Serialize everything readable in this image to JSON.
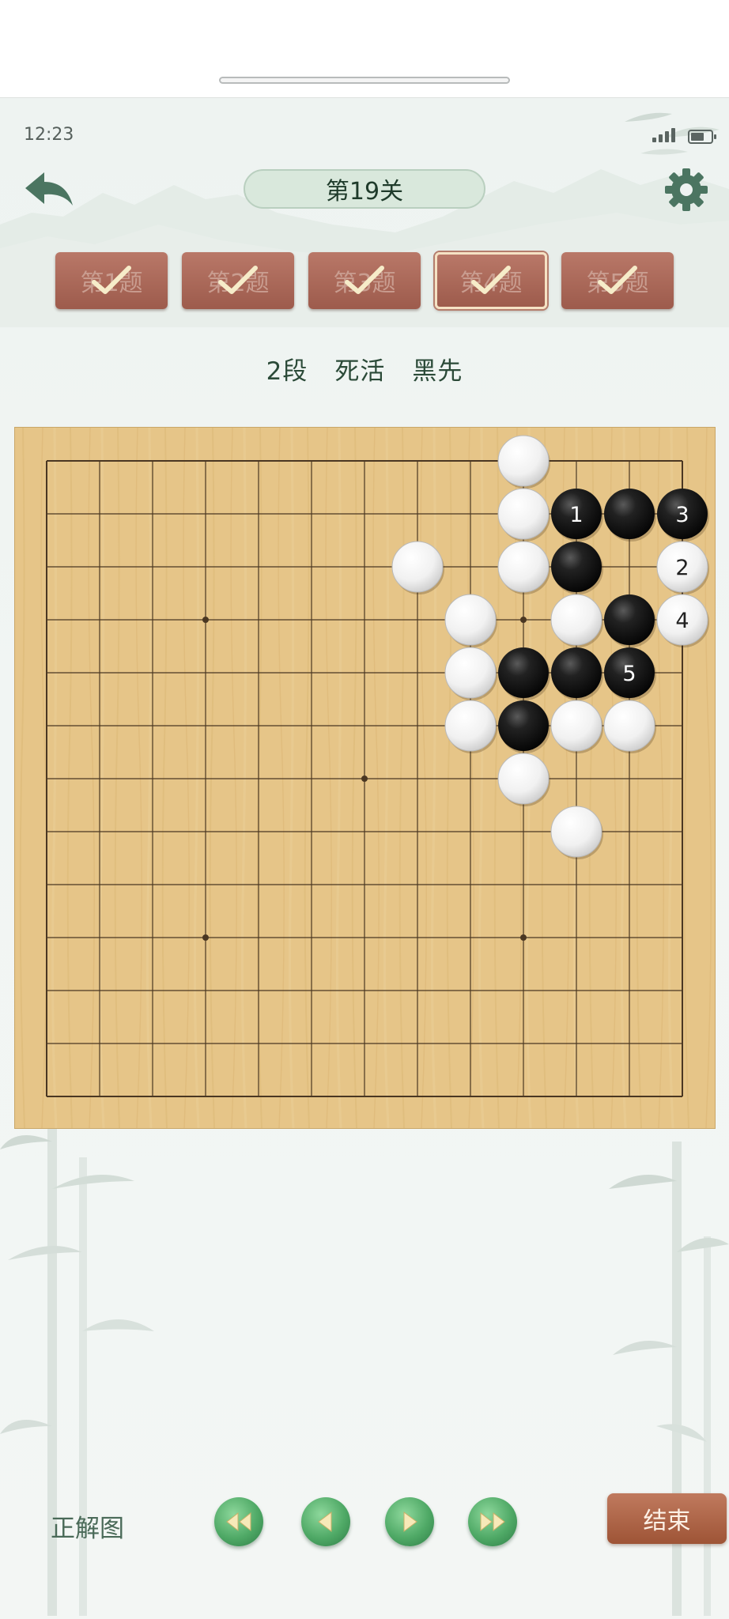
{
  "status": {
    "time": "12:23"
  },
  "header": {
    "title": "第19关",
    "back_icon": "back-arrow-icon",
    "settings_icon": "gear-icon"
  },
  "question_tabs": [
    {
      "label": "第1题",
      "completed": true,
      "active": false
    },
    {
      "label": "第2题",
      "completed": true,
      "active": false
    },
    {
      "label": "第3题",
      "completed": true,
      "active": false
    },
    {
      "label": "第4题",
      "completed": true,
      "active": true
    },
    {
      "label": "第5题",
      "completed": true,
      "active": false
    }
  ],
  "problem_info": {
    "rank": "2段",
    "category": "死活",
    "turn": "黑先"
  },
  "board": {
    "columns": 13,
    "rows": 13,
    "star_points": [
      [
        3,
        3
      ],
      [
        9,
        3
      ],
      [
        6,
        6
      ],
      [
        3,
        9
      ],
      [
        9,
        9
      ]
    ],
    "stones": [
      {
        "color": "white",
        "col": 9,
        "row": 0
      },
      {
        "color": "white",
        "col": 9,
        "row": 1
      },
      {
        "color": "black",
        "col": 10,
        "row": 1,
        "label": "1"
      },
      {
        "color": "black",
        "col": 11,
        "row": 1
      },
      {
        "color": "black",
        "col": 12,
        "row": 1,
        "label": "3"
      },
      {
        "color": "white",
        "col": 7,
        "row": 2
      },
      {
        "color": "white",
        "col": 9,
        "row": 2
      },
      {
        "color": "black",
        "col": 10,
        "row": 2
      },
      {
        "color": "white",
        "col": 12,
        "row": 2,
        "label": "2"
      },
      {
        "color": "white",
        "col": 8,
        "row": 3
      },
      {
        "color": "white",
        "col": 10,
        "row": 3
      },
      {
        "color": "black",
        "col": 11,
        "row": 3
      },
      {
        "color": "white",
        "col": 12,
        "row": 3,
        "label": "4"
      },
      {
        "color": "white",
        "col": 8,
        "row": 4
      },
      {
        "color": "black",
        "col": 9,
        "row": 4
      },
      {
        "color": "black",
        "col": 10,
        "row": 4
      },
      {
        "color": "black",
        "col": 11,
        "row": 4,
        "label": "5"
      },
      {
        "color": "white",
        "col": 8,
        "row": 5
      },
      {
        "color": "black",
        "col": 9,
        "row": 5
      },
      {
        "color": "white",
        "col": 10,
        "row": 5
      },
      {
        "color": "white",
        "col": 11,
        "row": 5
      },
      {
        "color": "white",
        "col": 9,
        "row": 6
      },
      {
        "color": "white",
        "col": 10,
        "row": 7
      }
    ]
  },
  "bottom": {
    "answer_label": "正解图",
    "controls": [
      {
        "name": "first-move",
        "icon": "double-left-icon"
      },
      {
        "name": "prev-move",
        "icon": "left-icon"
      },
      {
        "name": "next-move",
        "icon": "right-icon"
      },
      {
        "name": "last-move",
        "icon": "double-right-icon"
      }
    ],
    "end_label": "结束"
  },
  "colors": {
    "board": "#e6c588",
    "tab": "#a9604f",
    "title_pill": "#d9e8dc",
    "nav_button": "#4fa966",
    "end_button": "#b06a4d"
  }
}
